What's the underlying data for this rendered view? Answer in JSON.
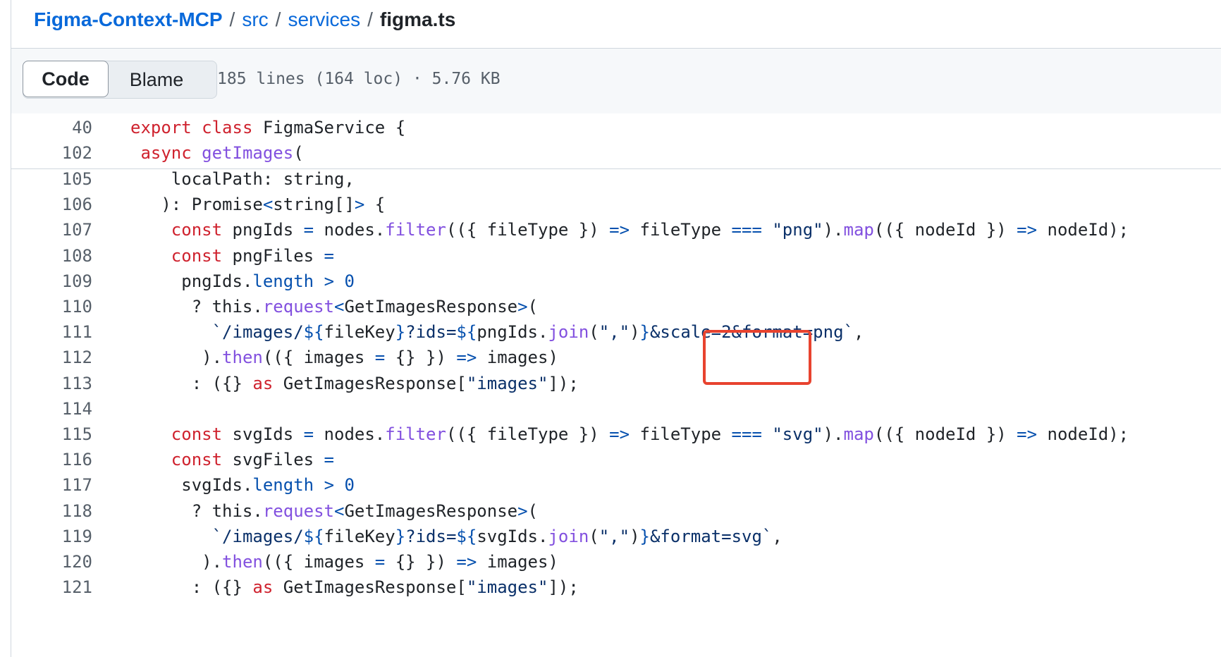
{
  "breadcrumb": {
    "repo": "Figma-Context-MCP",
    "dir1": "src",
    "dir2": "services",
    "file": "figma.ts",
    "separator": "/"
  },
  "toolbar": {
    "code_label": "Code",
    "blame_label": "Blame",
    "meta": "185 lines (164 loc) · 5.76 KB"
  },
  "sticky_lines": [
    {
      "n": "40",
      "tokens": [
        [
          "k",
          "export"
        ],
        [
          "p",
          " "
        ],
        [
          "k",
          "class"
        ],
        [
          "p",
          " FigmaService {"
        ]
      ]
    },
    {
      "n": "102",
      "tokens": [
        [
          "k",
          "async"
        ],
        [
          "p",
          " "
        ],
        [
          "f",
          "getImages"
        ],
        [
          "p",
          "("
        ]
      ]
    }
  ],
  "lines": [
    {
      "n": "105",
      "tokens": [
        [
          "p",
          "localPath: string,"
        ]
      ]
    },
    {
      "n": "106",
      "tokens": [
        [
          "p",
          "): Promise"
        ],
        [
          "c",
          "<"
        ],
        [
          "p",
          "string[]"
        ],
        [
          "c",
          ">"
        ],
        [
          "p",
          " {"
        ]
      ]
    },
    {
      "n": "107",
      "tokens": [
        [
          "k",
          "const"
        ],
        [
          "p",
          " pngIds "
        ],
        [
          "c",
          "="
        ],
        [
          "p",
          " nodes."
        ],
        [
          "f",
          "filter"
        ],
        [
          "p",
          "(({ fileType }) "
        ],
        [
          "c",
          "=>"
        ],
        [
          "p",
          " fileType "
        ],
        [
          "c",
          "==="
        ],
        [
          "p",
          " "
        ],
        [
          "s",
          "\"png\""
        ],
        [
          "p",
          ")."
        ],
        [
          "f",
          "map"
        ],
        [
          "p",
          "(({ nodeId }) "
        ],
        [
          "c",
          "=>"
        ],
        [
          "p",
          " nodeId);"
        ]
      ]
    },
    {
      "n": "108",
      "tokens": [
        [
          "k",
          "const"
        ],
        [
          "p",
          " pngFiles "
        ],
        [
          "c",
          "="
        ]
      ]
    },
    {
      "n": "109",
      "tokens": [
        [
          "p",
          "pngIds."
        ],
        [
          "c",
          "length"
        ],
        [
          "p",
          " "
        ],
        [
          "c",
          ">"
        ],
        [
          "p",
          " "
        ],
        [
          "c",
          "0"
        ]
      ]
    },
    {
      "n": "110",
      "tokens": [
        [
          "p",
          "? this."
        ],
        [
          "f",
          "request"
        ],
        [
          "c",
          "<"
        ],
        [
          "p",
          "GetImagesResponse"
        ],
        [
          "c",
          ">"
        ],
        [
          "p",
          "("
        ]
      ]
    },
    {
      "n": "111",
      "tokens": [
        [
          "s",
          "`/images/"
        ],
        [
          "c",
          "${"
        ],
        [
          "p",
          "fileKey"
        ],
        [
          "c",
          "}"
        ],
        [
          "s",
          "?ids="
        ],
        [
          "c",
          "${"
        ],
        [
          "p",
          "pngIds."
        ],
        [
          "f",
          "join"
        ],
        [
          "p",
          "("
        ],
        [
          "s",
          "\",\""
        ],
        [
          "p",
          ")"
        ],
        [
          "c",
          "}"
        ],
        [
          "s",
          "&scale=2&format=png`"
        ],
        [
          "p",
          ","
        ]
      ]
    },
    {
      "n": "112",
      "tokens": [
        [
          "p",
          ")."
        ],
        [
          "f",
          "then"
        ],
        [
          "p",
          "(({ images "
        ],
        [
          "c",
          "="
        ],
        [
          "p",
          " {} }) "
        ],
        [
          "c",
          "=>"
        ],
        [
          "p",
          " images)"
        ]
      ]
    },
    {
      "n": "113",
      "tokens": [
        [
          "p",
          ": ({} "
        ],
        [
          "k",
          "as"
        ],
        [
          "p",
          " GetImagesResponse["
        ],
        [
          "s",
          "\"images\""
        ],
        [
          "p",
          "]);"
        ]
      ]
    },
    {
      "n": "114",
      "tokens": []
    },
    {
      "n": "115",
      "tokens": [
        [
          "k",
          "const"
        ],
        [
          "p",
          " svgIds "
        ],
        [
          "c",
          "="
        ],
        [
          "p",
          " nodes."
        ],
        [
          "f",
          "filter"
        ],
        [
          "p",
          "(({ fileType }) "
        ],
        [
          "c",
          "=>"
        ],
        [
          "p",
          " fileType "
        ],
        [
          "c",
          "==="
        ],
        [
          "p",
          " "
        ],
        [
          "s",
          "\"svg\""
        ],
        [
          "p",
          ")."
        ],
        [
          "f",
          "map"
        ],
        [
          "p",
          "(({ nodeId }) "
        ],
        [
          "c",
          "=>"
        ],
        [
          "p",
          " nodeId);"
        ]
      ]
    },
    {
      "n": "116",
      "tokens": [
        [
          "k",
          "const"
        ],
        [
          "p",
          " svgFiles "
        ],
        [
          "c",
          "="
        ]
      ]
    },
    {
      "n": "117",
      "tokens": [
        [
          "p",
          "svgIds."
        ],
        [
          "c",
          "length"
        ],
        [
          "p",
          " "
        ],
        [
          "c",
          ">"
        ],
        [
          "p",
          " "
        ],
        [
          "c",
          "0"
        ]
      ]
    },
    {
      "n": "118",
      "tokens": [
        [
          "p",
          "? this."
        ],
        [
          "f",
          "request"
        ],
        [
          "c",
          "<"
        ],
        [
          "p",
          "GetImagesResponse"
        ],
        [
          "c",
          ">"
        ],
        [
          "p",
          "("
        ]
      ]
    },
    {
      "n": "119",
      "tokens": [
        [
          "s",
          "`/images/"
        ],
        [
          "c",
          "${"
        ],
        [
          "p",
          "fileKey"
        ],
        [
          "c",
          "}"
        ],
        [
          "s",
          "?ids="
        ],
        [
          "c",
          "${"
        ],
        [
          "p",
          "svgIds."
        ],
        [
          "f",
          "join"
        ],
        [
          "p",
          "("
        ],
        [
          "s",
          "\",\""
        ],
        [
          "p",
          ")"
        ],
        [
          "c",
          "}"
        ],
        [
          "s",
          "&format=svg`"
        ],
        [
          "p",
          ","
        ]
      ]
    },
    {
      "n": "120",
      "tokens": [
        [
          "p",
          ")."
        ],
        [
          "f",
          "then"
        ],
        [
          "p",
          "(({ images "
        ],
        [
          "c",
          "="
        ],
        [
          "p",
          " {} }) "
        ],
        [
          "c",
          "=>"
        ],
        [
          "p",
          " images)"
        ]
      ]
    },
    {
      "n": "121",
      "tokens": [
        [
          "p",
          ": ({} "
        ],
        [
          "k",
          "as"
        ],
        [
          "p",
          " GetImagesResponse["
        ],
        [
          "s",
          "\"images\""
        ],
        [
          "p",
          "]);"
        ]
      ]
    }
  ],
  "colors": {
    "keyword": "#cf222e",
    "function": "#8250df",
    "string": "#0a3069",
    "constant": "#0550ae",
    "link": "#0969da",
    "annotation_box": "#e8432f"
  }
}
